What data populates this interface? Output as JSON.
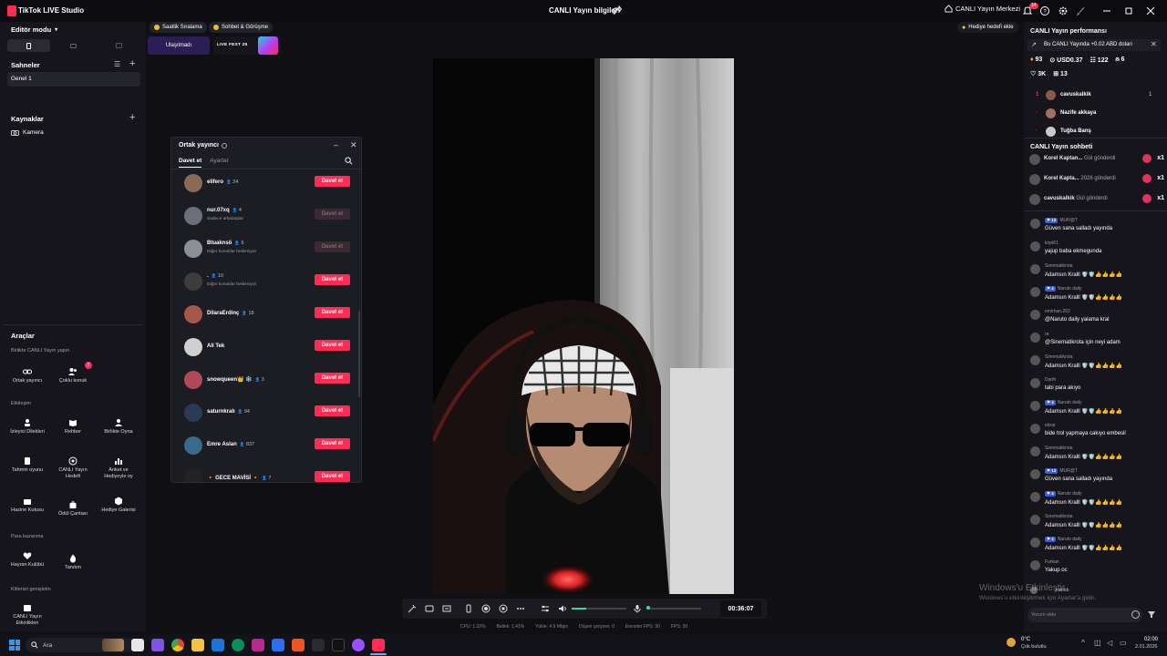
{
  "titlebar": {
    "app_name": "TikTok LIVE Studio",
    "center_title": "CANLI Yayın bilgileri",
    "live_center": "CANLI Yayın Merkezi",
    "notif_count": "14"
  },
  "left": {
    "editor_mode": "Editör modu",
    "scenes_title": "Sahneler",
    "scene_1": "Genel 1",
    "sources_title": "Kaynaklar",
    "source_camera": "Kamera",
    "tools_title": "Araçlar",
    "group_collab": "Birlikte CANLI Yayın yapın",
    "tool_cohost": "Ortak yayıncı",
    "tool_multi": "Çoklu konuk",
    "multi_badge": "1",
    "group_interaction": "Etkileşim",
    "tool_viewer_wishes": "İzleyici Dilekleri",
    "tool_guide": "Rehber",
    "tool_play_together": "Birlikte Oyna",
    "tool_guess": "Tahmin oyunu",
    "tool_live_goal": "CANLI Yayın Hedefi",
    "tool_poll": "Anket ve Hediyeyle oy",
    "tool_treasure": "Hazine Kutusu",
    "tool_reward_bag": "Ödül Çantası",
    "tool_gift_gallery": "Hediye Galerisi",
    "group_earn": "Para kazanma",
    "tool_fan_club": "Hayran Kulübü",
    "tool_promote": "Tanıtım",
    "group_grow": "Kitlenizi genişletin",
    "tool_live_events": "CANLI Yayın Etkinlikleri"
  },
  "chips": {
    "hourly": "Saatlik Sıralama",
    "chat_meet": "Sohbet & Görüşme",
    "reached": "Ulaşılmadı",
    "livefest": "LIVE FEST 25",
    "gift_goal": "Hediye hedefi ekle"
  },
  "modal": {
    "title": "Ortak yayıncı",
    "tab_invite": "Davet et",
    "tab_settings": "Ayarlar",
    "rows": [
      {
        "name": "elifero",
        "count": "24",
        "sub": "",
        "btn": "Davet et",
        "enabled": true,
        "color": "#8a6a55"
      },
      {
        "name": "nur.07xq",
        "count": "4",
        "sub": "Sadece arkadaşlar",
        "btn": "Davet et",
        "enabled": false,
        "color": "#6b6f7a"
      },
      {
        "name": "Btuaknsö",
        "count": "6",
        "sub": "Diğer konuklar bekleniyor",
        "btn": "Davet et",
        "enabled": false,
        "color": "#8b8f96"
      },
      {
        "name": ".",
        "count": "10",
        "sub": "Diğer konuklar bekleniyor",
        "btn": "Davet et",
        "enabled": true,
        "color": "#3c3c3c"
      },
      {
        "name": "DilaraErdinç",
        "count": "18",
        "sub": "",
        "btn": "Davet et",
        "enabled": true,
        "color": "#a5574a"
      },
      {
        "name": "Ali Tek",
        "count": "",
        "sub": "",
        "btn": "Davet et",
        "enabled": true,
        "color": "#d0d0d0"
      },
      {
        "name": "snowqueen👑 ❄️",
        "count": "3",
        "sub": "",
        "btn": "Davet et",
        "enabled": true,
        "color": "#b04a58"
      },
      {
        "name": "saturnkralı",
        "count": "94",
        "sub": "",
        "btn": "Davet et",
        "enabled": true,
        "color": "#2a3a55"
      },
      {
        "name": "Emre Aslan",
        "count": "837",
        "sub": "",
        "btn": "Davet et",
        "enabled": true,
        "color": "#3a6a8a"
      },
      {
        "name": "🔸 GECE MAVİSİ 🔸",
        "count": "7",
        "sub": "",
        "btn": "Davet et",
        "enabled": true,
        "color": "#222"
      }
    ]
  },
  "controls": {
    "timer": "00:36:07",
    "stats": [
      "CPU: 1.32%",
      "Bellek: 1.41%",
      "Yükle: 4.9 Mbps",
      "Düşen çerçeve: 0",
      "Encoder FPS: 30",
      "FPS: 30"
    ]
  },
  "performance": {
    "title": "CANLI Yayın performansı",
    "earn_line": "Bu CANLI Yayında +0.02 ABD doları",
    "diamonds": "93",
    "usd": "USD0.37",
    "viewers": "122",
    "new": "6",
    "likes": "3K",
    "shares": "13",
    "ranking": [
      {
        "rank": "1",
        "name": "cavuskalkik",
        "score": "1"
      },
      {
        "rank": "·",
        "name": "Nazife akkaya",
        "score": ""
      },
      {
        "rank": "·",
        "name": "Tuğba Banş",
        "score": ""
      }
    ]
  },
  "chat": {
    "title": "CANLI Yayın sohbeti",
    "gifts": [
      {
        "user": "Korel Kaptan...",
        "text": "Gül gönderdi",
        "x": "x1"
      },
      {
        "user": "Korel Kapta...",
        "text": "2026 gönderdi",
        "x": "x1"
      },
      {
        "user": "cavuskalkik",
        "text": "Gül gönderdi",
        "x": "x1"
      }
    ],
    "messages": [
      {
        "user": "MUR@T",
        "level": "13",
        "text": "Güven sana salladı yayında"
      },
      {
        "user": "kirpi61",
        "level": "",
        "text": "yajup baba ekmegunda"
      },
      {
        "user": "Sinematikrota",
        "level": "",
        "text": "Adamsın Kralll 🛡️🛡️👍👍👍👍"
      },
      {
        "user": "Naruto daily",
        "level": "4",
        "text": "Adamsın Kralll 🛡️🛡️👍👍👍👍"
      },
      {
        "user": "emirhan.262",
        "level": "",
        "text": "@Naruto daily yalama kral"
      },
      {
        "user": "ra",
        "level": "",
        "text": "@Sinematikrota için neyi adam"
      },
      {
        "user": "Sinematikrota",
        "level": "",
        "text": "Adamsın Kralll 🛡️🛡️👍👍👍👍"
      },
      {
        "user": "Darth",
        "level": "",
        "text": "tabi para akıyo"
      },
      {
        "user": "Naruto daily",
        "level": "4",
        "text": "Adamsın Kralll 🛡️🛡️👍👍👍👍"
      },
      {
        "user": "ebrar",
        "level": "",
        "text": "bide trol yapmaya cakıyo embesil"
      },
      {
        "user": "Sinematikrota",
        "level": "",
        "text": "Adamsın Kralll 🛡️🛡️👍👍👍👍"
      },
      {
        "user": "MUR@T",
        "level": "13",
        "text": "Güven sana salladı yayında"
      },
      {
        "user": "Naruto daily",
        "level": "4",
        "text": "Adamsın Kralll 🛡️🛡️👍👍👍👍"
      },
      {
        "user": "Sinematikrota",
        "level": "",
        "text": "Adamsın Kralll 🛡️🛡️👍👍👍👍"
      },
      {
        "user": "Naruto daily",
        "level": "4",
        "text": "Adamsın Kralll 🛡️🛡️👍👍👍👍"
      },
      {
        "user": "Furkan",
        "level": "",
        "text": "Yakup oc"
      }
    ],
    "joined": "katıldı",
    "input_placeholder": "Yorum ekle"
  },
  "watermark": {
    "line1": "Windows'u Etkinleştir",
    "line2": "Windows'u etkinleştirmek için Ayarlar'a gidin."
  },
  "taskbar": {
    "search": "Ara",
    "weather_temp": "0°C",
    "weather_desc": "Çok bulutlu",
    "time": "02:00",
    "date": "2.01.2026"
  },
  "colors": {
    "accent": "#fe2c55",
    "panel": "#15151b",
    "bg": "#0f0f14",
    "level_badge": "#3b5bd9"
  }
}
